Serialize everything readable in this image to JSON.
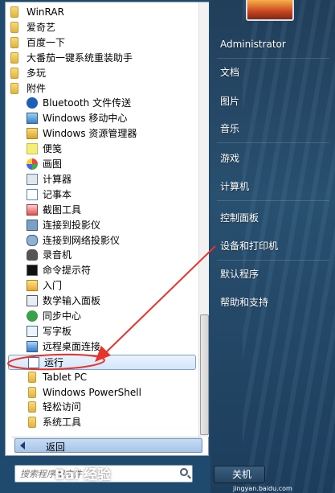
{
  "programs": {
    "items": [
      {
        "label": "WinRAR",
        "kind": "folder"
      },
      {
        "label": "爱奇艺",
        "kind": "folder"
      },
      {
        "label": "百度一下",
        "kind": "folder"
      },
      {
        "label": "大番茄一键系统重装助手",
        "kind": "folder"
      },
      {
        "label": "多玩",
        "kind": "folder"
      },
      {
        "label": "附件",
        "kind": "folder"
      },
      {
        "label": "Bluetooth 文件传送",
        "kind": "sub",
        "icon": "bluetooth-icon"
      },
      {
        "label": "Windows 移动中心",
        "kind": "sub",
        "icon": "mobility-center-icon"
      },
      {
        "label": "Windows 资源管理器",
        "kind": "sub",
        "icon": "explorer-icon"
      },
      {
        "label": "便笺",
        "kind": "sub",
        "icon": "sticky-notes-icon"
      },
      {
        "label": "画图",
        "kind": "sub",
        "icon": "paint-icon"
      },
      {
        "label": "计算器",
        "kind": "sub",
        "icon": "calculator-icon"
      },
      {
        "label": "记事本",
        "kind": "sub",
        "icon": "notepad-icon"
      },
      {
        "label": "截图工具",
        "kind": "sub",
        "icon": "snipping-tool-icon"
      },
      {
        "label": "连接到投影仪",
        "kind": "sub",
        "icon": "projector-icon"
      },
      {
        "label": "连接到网络投影仪",
        "kind": "sub",
        "icon": "network-projector-icon"
      },
      {
        "label": "录音机",
        "kind": "sub",
        "icon": "microphone-icon"
      },
      {
        "label": "命令提示符",
        "kind": "sub",
        "icon": "cmd-icon"
      },
      {
        "label": "入门",
        "kind": "sub",
        "icon": "getting-started-icon"
      },
      {
        "label": "数学输入面板",
        "kind": "sub",
        "icon": "math-input-icon"
      },
      {
        "label": "同步中心",
        "kind": "sub",
        "icon": "sync-center-icon"
      },
      {
        "label": "写字板",
        "kind": "sub",
        "icon": "wordpad-icon"
      },
      {
        "label": "远程桌面连接",
        "kind": "sub",
        "icon": "remote-desktop-icon"
      },
      {
        "label": "运行",
        "kind": "sub",
        "icon": "run-icon",
        "selected": true
      },
      {
        "label": "Tablet PC",
        "kind": "subfolder"
      },
      {
        "label": "Windows PowerShell",
        "kind": "subfolder"
      },
      {
        "label": "轻松访问",
        "kind": "subfolder"
      },
      {
        "label": "系统工具",
        "kind": "subfolder"
      }
    ]
  },
  "back_label": "返回",
  "search": {
    "placeholder": "搜索程序和文件"
  },
  "right_menu": {
    "items": [
      "Administrator",
      "文档",
      "图片",
      "音乐",
      "游戏",
      "计算机",
      "控制面板",
      "设备和打印机",
      "默认程序",
      "帮助和支持"
    ]
  },
  "shutdown_label": "关机",
  "watermark": "Bai 经验",
  "watermark_sub": "jingyan.baidu.com",
  "colors": {
    "annotation": "#e8332b",
    "folder": "#e9c24f",
    "selection": "#d4e6fb"
  }
}
